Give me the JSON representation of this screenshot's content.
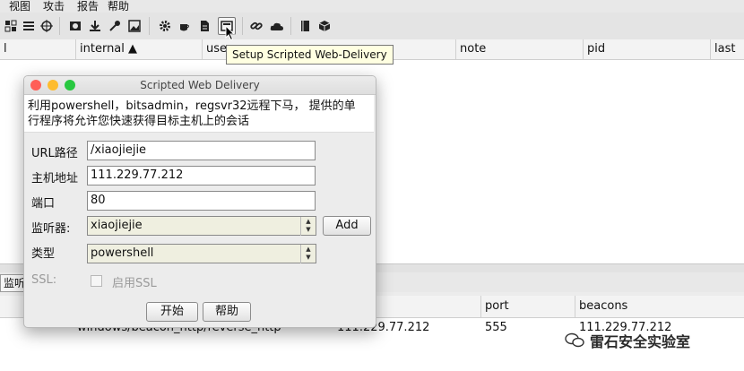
{
  "menu": [
    "视图",
    "攻击",
    "报告",
    "帮助"
  ],
  "toolbar": {
    "icons": [
      "connect-icon",
      "list-icon",
      "crosshair-icon",
      "image-icon",
      "download-icon",
      "key-icon",
      "picture-icon",
      "gear-icon",
      "coffee-icon",
      "document-icon",
      "scripted-delivery-icon",
      "link-icon",
      "cloud-icon",
      "book-icon",
      "cube-icon"
    ]
  },
  "tooltip": "Setup Scripted Web-Delivery",
  "top_table": {
    "columns": [
      "l",
      "internal ▲",
      "use",
      "note",
      "pid",
      "last"
    ]
  },
  "bottom_tab": "监听器",
  "bottom_table": {
    "columns": [
      "port",
      "beacons"
    ],
    "row": {
      "payload": "windows/beacon_http/reverse_http",
      "host": "111.229.77.212",
      "port": "555",
      "beacons": "111.229.77.212"
    }
  },
  "watermark": "雷石安全实验室",
  "dialog": {
    "title": "Scripted Web Delivery",
    "desc_line1": "利用powershell，bitsadmin，regsvr32远程下马， 提供的单",
    "desc_line2": "行程序将允许您快速获得目标主机上的会话",
    "fields": {
      "url_label": "URL路径",
      "url_value": "/xiaojiejie",
      "host_label": "主机地址",
      "host_value": "111.229.77.212",
      "port_label": "端口",
      "port_value": "80",
      "listener_label": "监听器:",
      "listener_value": "xiaojiejie",
      "type_label": "类型",
      "type_value": "powershell",
      "ssl_label": "SSL:",
      "ssl_checkbox_label": "启用SSL"
    },
    "add_label": "Add",
    "launch_label": "开始",
    "help_label": "帮助"
  },
  "colors": {
    "close": "#ff5f57",
    "minimize": "#febc2e",
    "zoom": "#28c840",
    "tooltip_bg": "#ffffe1"
  }
}
